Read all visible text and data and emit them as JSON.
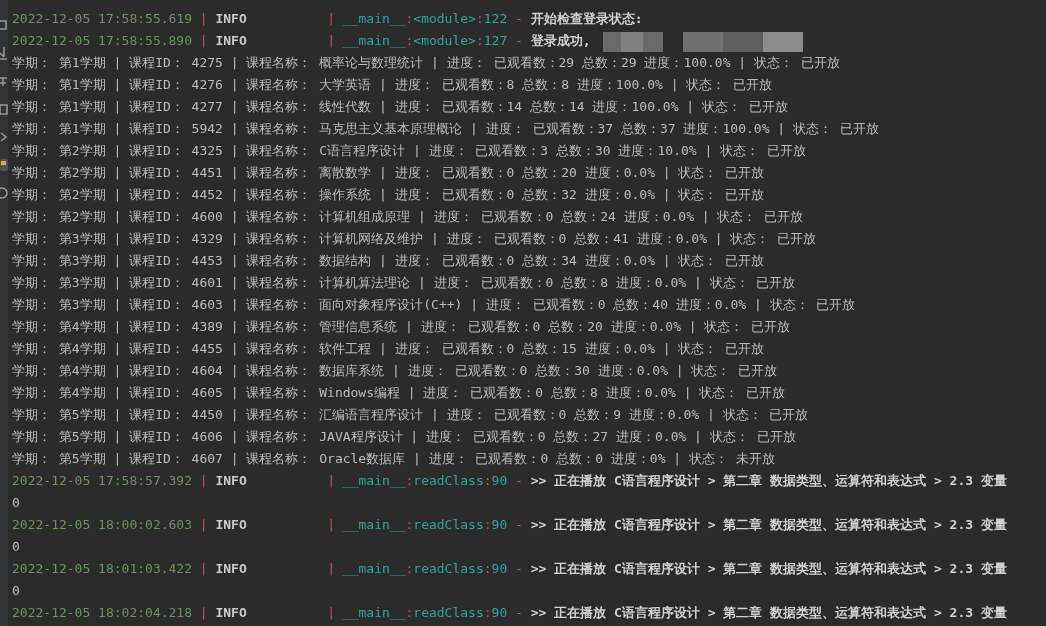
{
  "console": {
    "lines": [
      {
        "kind": "log",
        "redacted": false,
        "segments": [
          {
            "kind": "timestamp",
            "text": "2022-12-05 17:58:55.619"
          },
          {
            "kind": "separator",
            "text": "|"
          },
          {
            "kind": "level",
            "text": "INFO"
          },
          {
            "kind": "separator",
            "text": "|"
          },
          {
            "kind": "source",
            "text": "__main__"
          },
          {
            "kind": "colon",
            "text": ":"
          },
          {
            "kind": "source",
            "text": "<module>"
          },
          {
            "kind": "colon",
            "text": ":"
          },
          {
            "kind": "source",
            "text": "122"
          },
          {
            "kind": "separator",
            "text": "-"
          },
          {
            "kind": "message",
            "text": "开始检查登录状态:"
          }
        ]
      },
      {
        "kind": "log",
        "redacted": true,
        "segments": [
          {
            "kind": "timestamp",
            "text": "2022-12-05 17:58:55.890"
          },
          {
            "kind": "separator",
            "text": "|"
          },
          {
            "kind": "level",
            "text": "INFO"
          },
          {
            "kind": "separator",
            "text": "|"
          },
          {
            "kind": "source",
            "text": "__main__"
          },
          {
            "kind": "colon",
            "text": ":"
          },
          {
            "kind": "source",
            "text": "<module>"
          },
          {
            "kind": "colon",
            "text": ":"
          },
          {
            "kind": "source",
            "text": "127"
          },
          {
            "kind": "separator",
            "text": "-"
          },
          {
            "kind": "message",
            "text": "登录成功,"
          }
        ]
      },
      {
        "kind": "output",
        "text": "学期： 第1学期 | 课程ID： 4275 | 课程名称： 概率论与数理统计 | 进度： 已观看数：29 总数：29 进度：100.0% | 状态： 已开放"
      },
      {
        "kind": "output",
        "text": "学期： 第1学期 | 课程ID： 4276 | 课程名称： 大学英语 | 进度： 已观看数：8 总数：8 进度：100.0% | 状态： 已开放"
      },
      {
        "kind": "output",
        "text": "学期： 第1学期 | 课程ID： 4277 | 课程名称： 线性代数 | 进度： 已观看数：14 总数：14 进度：100.0% | 状态： 已开放"
      },
      {
        "kind": "output",
        "text": "学期： 第1学期 | 课程ID： 5942 | 课程名称： 马克思主义基本原理概论 | 进度： 已观看数：37 总数：37 进度：100.0% | 状态： 已开放"
      },
      {
        "kind": "output",
        "text": "学期： 第2学期 | 课程ID： 4325 | 课程名称： C语言程序设计 | 进度： 已观看数：3 总数：30 进度：10.0% | 状态： 已开放"
      },
      {
        "kind": "output",
        "text": "学期： 第2学期 | 课程ID： 4451 | 课程名称： 离散数学 | 进度： 已观看数：0 总数：20 进度：0.0% | 状态： 已开放"
      },
      {
        "kind": "output",
        "text": "学期： 第2学期 | 课程ID： 4452 | 课程名称： 操作系统 | 进度： 已观看数：0 总数：32 进度：0.0% | 状态： 已开放"
      },
      {
        "kind": "output",
        "text": "学期： 第2学期 | 课程ID： 4600 | 课程名称： 计算机组成原理 | 进度： 已观看数：0 总数：24 进度：0.0% | 状态： 已开放"
      },
      {
        "kind": "output",
        "text": "学期： 第3学期 | 课程ID： 4329 | 课程名称： 计算机网络及维护 | 进度： 已观看数：0 总数：41 进度：0.0% | 状态： 已开放"
      },
      {
        "kind": "output",
        "text": "学期： 第3学期 | 课程ID： 4453 | 课程名称： 数据结构 | 进度： 已观看数：0 总数：34 进度：0.0% | 状态： 已开放"
      },
      {
        "kind": "output",
        "text": "学期： 第3学期 | 课程ID： 4601 | 课程名称： 计算机算法理论 | 进度： 已观看数：0 总数：8 进度：0.0% | 状态： 已开放"
      },
      {
        "kind": "output",
        "text": "学期： 第3学期 | 课程ID： 4603 | 课程名称： 面向对象程序设计(C++) | 进度： 已观看数：0 总数：40 进度：0.0% | 状态： 已开放"
      },
      {
        "kind": "output",
        "text": "学期： 第4学期 | 课程ID： 4389 | 课程名称： 管理信息系统 | 进度： 已观看数：0 总数：20 进度：0.0% | 状态： 已开放"
      },
      {
        "kind": "output",
        "text": "学期： 第4学期 | 课程ID： 4455 | 课程名称： 软件工程 | 进度： 已观看数：0 总数：15 进度：0.0% | 状态： 已开放"
      },
      {
        "kind": "output",
        "text": "学期： 第4学期 | 课程ID： 4604 | 课程名称： 数据库系统 | 进度： 已观看数：0 总数：30 进度：0.0% | 状态： 已开放"
      },
      {
        "kind": "output",
        "text": "学期： 第4学期 | 课程ID： 4605 | 课程名称： Windows编程 | 进度： 已观看数：0 总数：8 进度：0.0% | 状态： 已开放"
      },
      {
        "kind": "output",
        "text": "学期： 第5学期 | 课程ID： 4450 | 课程名称： 汇编语言程序设计 | 进度： 已观看数：0 总数：9 进度：0.0% | 状态： 已开放"
      },
      {
        "kind": "output",
        "text": "学期： 第5学期 | 课程ID： 4606 | 课程名称： JAVA程序设计 | 进度： 已观看数：0 总数：27 进度：0.0% | 状态： 已开放"
      },
      {
        "kind": "output",
        "text": "学期： 第5学期 | 课程ID： 4607 | 课程名称： Oracle数据库 | 进度： 已观看数：0 总数：0 进度：0% | 状态： 未开放"
      },
      {
        "kind": "log",
        "segments": [
          {
            "kind": "timestamp",
            "text": "2022-12-05 17:58:57.392"
          },
          {
            "kind": "separator",
            "text": "|"
          },
          {
            "kind": "level",
            "text": "INFO"
          },
          {
            "kind": "separator",
            "text": "|"
          },
          {
            "kind": "source",
            "text": "__main__"
          },
          {
            "kind": "colon",
            "text": ":"
          },
          {
            "kind": "source",
            "text": "readClass"
          },
          {
            "kind": "colon",
            "text": ":"
          },
          {
            "kind": "source",
            "text": "90"
          },
          {
            "kind": "separator",
            "text": "-"
          },
          {
            "kind": "message",
            "text": ">> 正在播放 C语言程序设计 > 第二章 数据类型、运算符和表达式 > 2.3 变量"
          }
        ]
      },
      {
        "kind": "output",
        "text": "0"
      },
      {
        "kind": "log",
        "segments": [
          {
            "kind": "timestamp",
            "text": "2022-12-05 18:00:02.603"
          },
          {
            "kind": "separator",
            "text": "|"
          },
          {
            "kind": "level",
            "text": "INFO"
          },
          {
            "kind": "separator",
            "text": "|"
          },
          {
            "kind": "source",
            "text": "__main__"
          },
          {
            "kind": "colon",
            "text": ":"
          },
          {
            "kind": "source",
            "text": "readClass"
          },
          {
            "kind": "colon",
            "text": ":"
          },
          {
            "kind": "source",
            "text": "90"
          },
          {
            "kind": "separator",
            "text": "-"
          },
          {
            "kind": "message",
            "text": ">> 正在播放 C语言程序设计 > 第二章 数据类型、运算符和表达式 > 2.3 变量"
          }
        ]
      },
      {
        "kind": "output",
        "text": "0"
      },
      {
        "kind": "log",
        "segments": [
          {
            "kind": "timestamp",
            "text": "2022-12-05 18:01:03.422"
          },
          {
            "kind": "separator",
            "text": "|"
          },
          {
            "kind": "level",
            "text": "INFO"
          },
          {
            "kind": "separator",
            "text": "|"
          },
          {
            "kind": "source",
            "text": "__main__"
          },
          {
            "kind": "colon",
            "text": ":"
          },
          {
            "kind": "source",
            "text": "readClass"
          },
          {
            "kind": "colon",
            "text": ":"
          },
          {
            "kind": "source",
            "text": "90"
          },
          {
            "kind": "separator",
            "text": "-"
          },
          {
            "kind": "message",
            "text": ">> 正在播放 C语言程序设计 > 第二章 数据类型、运算符和表达式 > 2.3 变量"
          }
        ]
      },
      {
        "kind": "output",
        "text": "0"
      },
      {
        "kind": "log",
        "segments": [
          {
            "kind": "timestamp",
            "text": "2022-12-05 18:02:04.218"
          },
          {
            "kind": "separator",
            "text": "|"
          },
          {
            "kind": "level",
            "text": "INFO"
          },
          {
            "kind": "separator",
            "text": "|"
          },
          {
            "kind": "source",
            "text": "__main__"
          },
          {
            "kind": "colon",
            "text": ":"
          },
          {
            "kind": "source",
            "text": "readClass"
          },
          {
            "kind": "colon",
            "text": ":"
          },
          {
            "kind": "source",
            "text": "90"
          },
          {
            "kind": "separator",
            "text": "-"
          },
          {
            "kind": "message",
            "text": ">> 正在播放 C语言程序设计 > 第二章 数据类型、运算符和表达式 > 2.3 变量"
          }
        ]
      }
    ]
  }
}
